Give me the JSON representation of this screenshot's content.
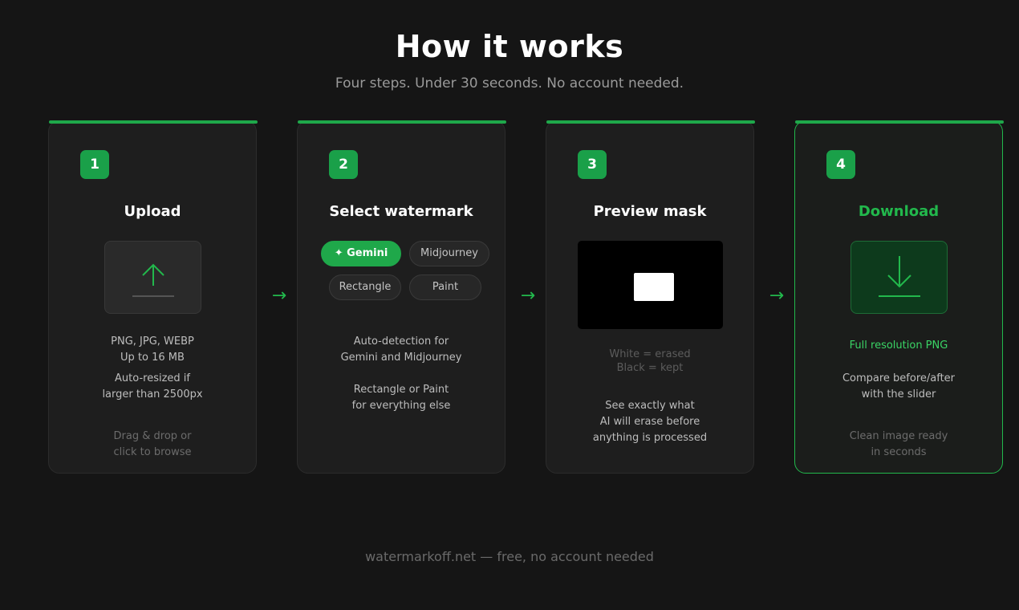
{
  "header": {
    "title": "How it works",
    "subtitle": "Four steps. Under 30 seconds. No account needed."
  },
  "steps": [
    {
      "number": "1",
      "title": "Upload",
      "icon": "upload-icon",
      "line1": "PNG, JPG, WEBP",
      "line2": "Up to 16 MB",
      "line3": "Auto-resized if",
      "line4": "larger than 2500px",
      "hint1": "Drag & drop or",
      "hint2": "click to browse"
    },
    {
      "number": "2",
      "title": "Select watermark",
      "options": [
        "✦ Gemini",
        "Midjourney",
        "Rectangle",
        "Paint"
      ],
      "selected_option": "✦ Gemini",
      "line1": "Auto-detection for",
      "line2": "Gemini and Midjourney",
      "line3": "Rectangle or Paint",
      "line4": "for everything else"
    },
    {
      "number": "3",
      "title": "Preview mask",
      "legend1": "White = erased",
      "legend2": "Black = kept",
      "line1": "See exactly what",
      "line2": "AI will erase before",
      "line3": "anything is processed"
    },
    {
      "number": "4",
      "title": "Download",
      "icon": "download-icon",
      "highlight": "Full resolution PNG",
      "line1": "Compare before/after",
      "line2": "with the slider",
      "hint1": "Clean image ready",
      "hint2": "in seconds"
    }
  ],
  "arrow_glyph": "→",
  "footer": "watermarkoff.net — free, no account needed",
  "colors": {
    "accent": "#22b84c",
    "background": "#151515",
    "card": "#1e1e1e"
  }
}
